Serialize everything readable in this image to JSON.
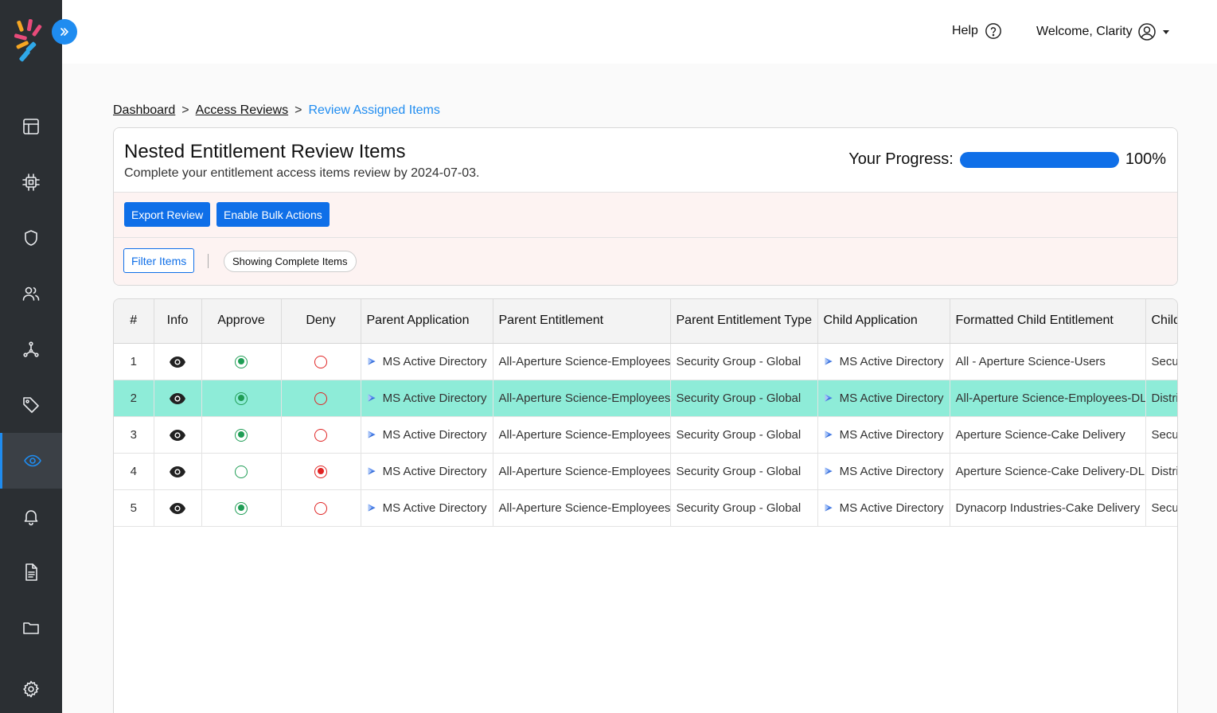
{
  "header": {
    "help_label": "Help",
    "welcome_label": "Welcome, Clarity"
  },
  "sidebar": {
    "items": [
      {
        "icon": "table-icon",
        "active": false
      },
      {
        "icon": "chip-icon",
        "active": false
      },
      {
        "icon": "shield-icon",
        "active": false
      },
      {
        "icon": "users-icon",
        "active": false
      },
      {
        "icon": "network-icon",
        "active": false
      },
      {
        "icon": "tag-icon",
        "active": false
      },
      {
        "icon": "eye-icon",
        "active": true
      },
      {
        "icon": "bell-icon",
        "active": false
      },
      {
        "icon": "document-icon",
        "active": false
      },
      {
        "icon": "folder-icon",
        "active": false
      },
      {
        "icon": "gear-icon",
        "active": false
      }
    ]
  },
  "breadcrumb": {
    "items": [
      "Dashboard",
      "Access Reviews"
    ],
    "separator": ">",
    "current": "Review Assigned Items"
  },
  "card": {
    "title": "Nested Entitlement Review Items",
    "subtitle": "Complete your entitlement access items review by 2024-07-03.",
    "progress_label": "Your Progress:",
    "progress_value": 100,
    "progress_text": "100%",
    "export_label": "Export Review",
    "bulk_label": "Enable Bulk Actions",
    "filter_label": "Filter Items",
    "showing_label": "Showing Complete Items"
  },
  "table": {
    "columns": [
      "#",
      "Info",
      "Approve",
      "Deny",
      "Parent Application",
      "Parent Entitlement",
      "Parent Entitlement Type",
      "Child Application",
      "Formatted Child Entitlement",
      "Child Entitlement Type"
    ],
    "rows": [
      {
        "num": "1",
        "decision": "approve",
        "parent_app": "MS Active Directory",
        "parent_ent": "All-Aperture Science-Employees",
        "parent_type": "Security Group - Global",
        "child_app": "MS Active Directory",
        "child_ent": "All - Aperture Science-Users",
        "child_type": "Security Group - Global",
        "highlight": false
      },
      {
        "num": "2",
        "decision": "approve",
        "parent_app": "MS Active Directory",
        "parent_ent": "All-Aperture Science-Employees",
        "parent_type": "Security Group - Global",
        "child_app": "MS Active Directory",
        "child_ent": "All-Aperture Science-Employees-DL",
        "child_type": "Distribution Group - Global",
        "highlight": true
      },
      {
        "num": "3",
        "decision": "approve",
        "parent_app": "MS Active Directory",
        "parent_ent": "All-Aperture Science-Employees",
        "parent_type": "Security Group - Global",
        "child_app": "MS Active Directory",
        "child_ent": "Aperture Science-Cake Delivery",
        "child_type": "Security Group - Global",
        "highlight": false
      },
      {
        "num": "4",
        "decision": "deny",
        "parent_app": "MS Active Directory",
        "parent_ent": "All-Aperture Science-Employees",
        "parent_type": "Security Group - Global",
        "child_app": "MS Active Directory",
        "child_ent": "Aperture Science-Cake Delivery-DL",
        "child_type": "Distribution Group - Global",
        "highlight": false
      },
      {
        "num": "5",
        "decision": "approve",
        "parent_app": "MS Active Directory",
        "parent_ent": "All-Aperture Science-Employees",
        "parent_type": "Security Group - Global",
        "child_app": "MS Active Directory",
        "child_ent": "Dynacorp Industries-Cake Delivery",
        "child_type": "Security Group - Global",
        "highlight": false
      }
    ]
  },
  "colors": {
    "accent": "#1f8cf0",
    "primary_button": "#0f6fe8",
    "sidebar": "#2b2f33",
    "row_highlight": "#8eecd8",
    "approve": "#1f9d55",
    "deny": "#e02424"
  }
}
